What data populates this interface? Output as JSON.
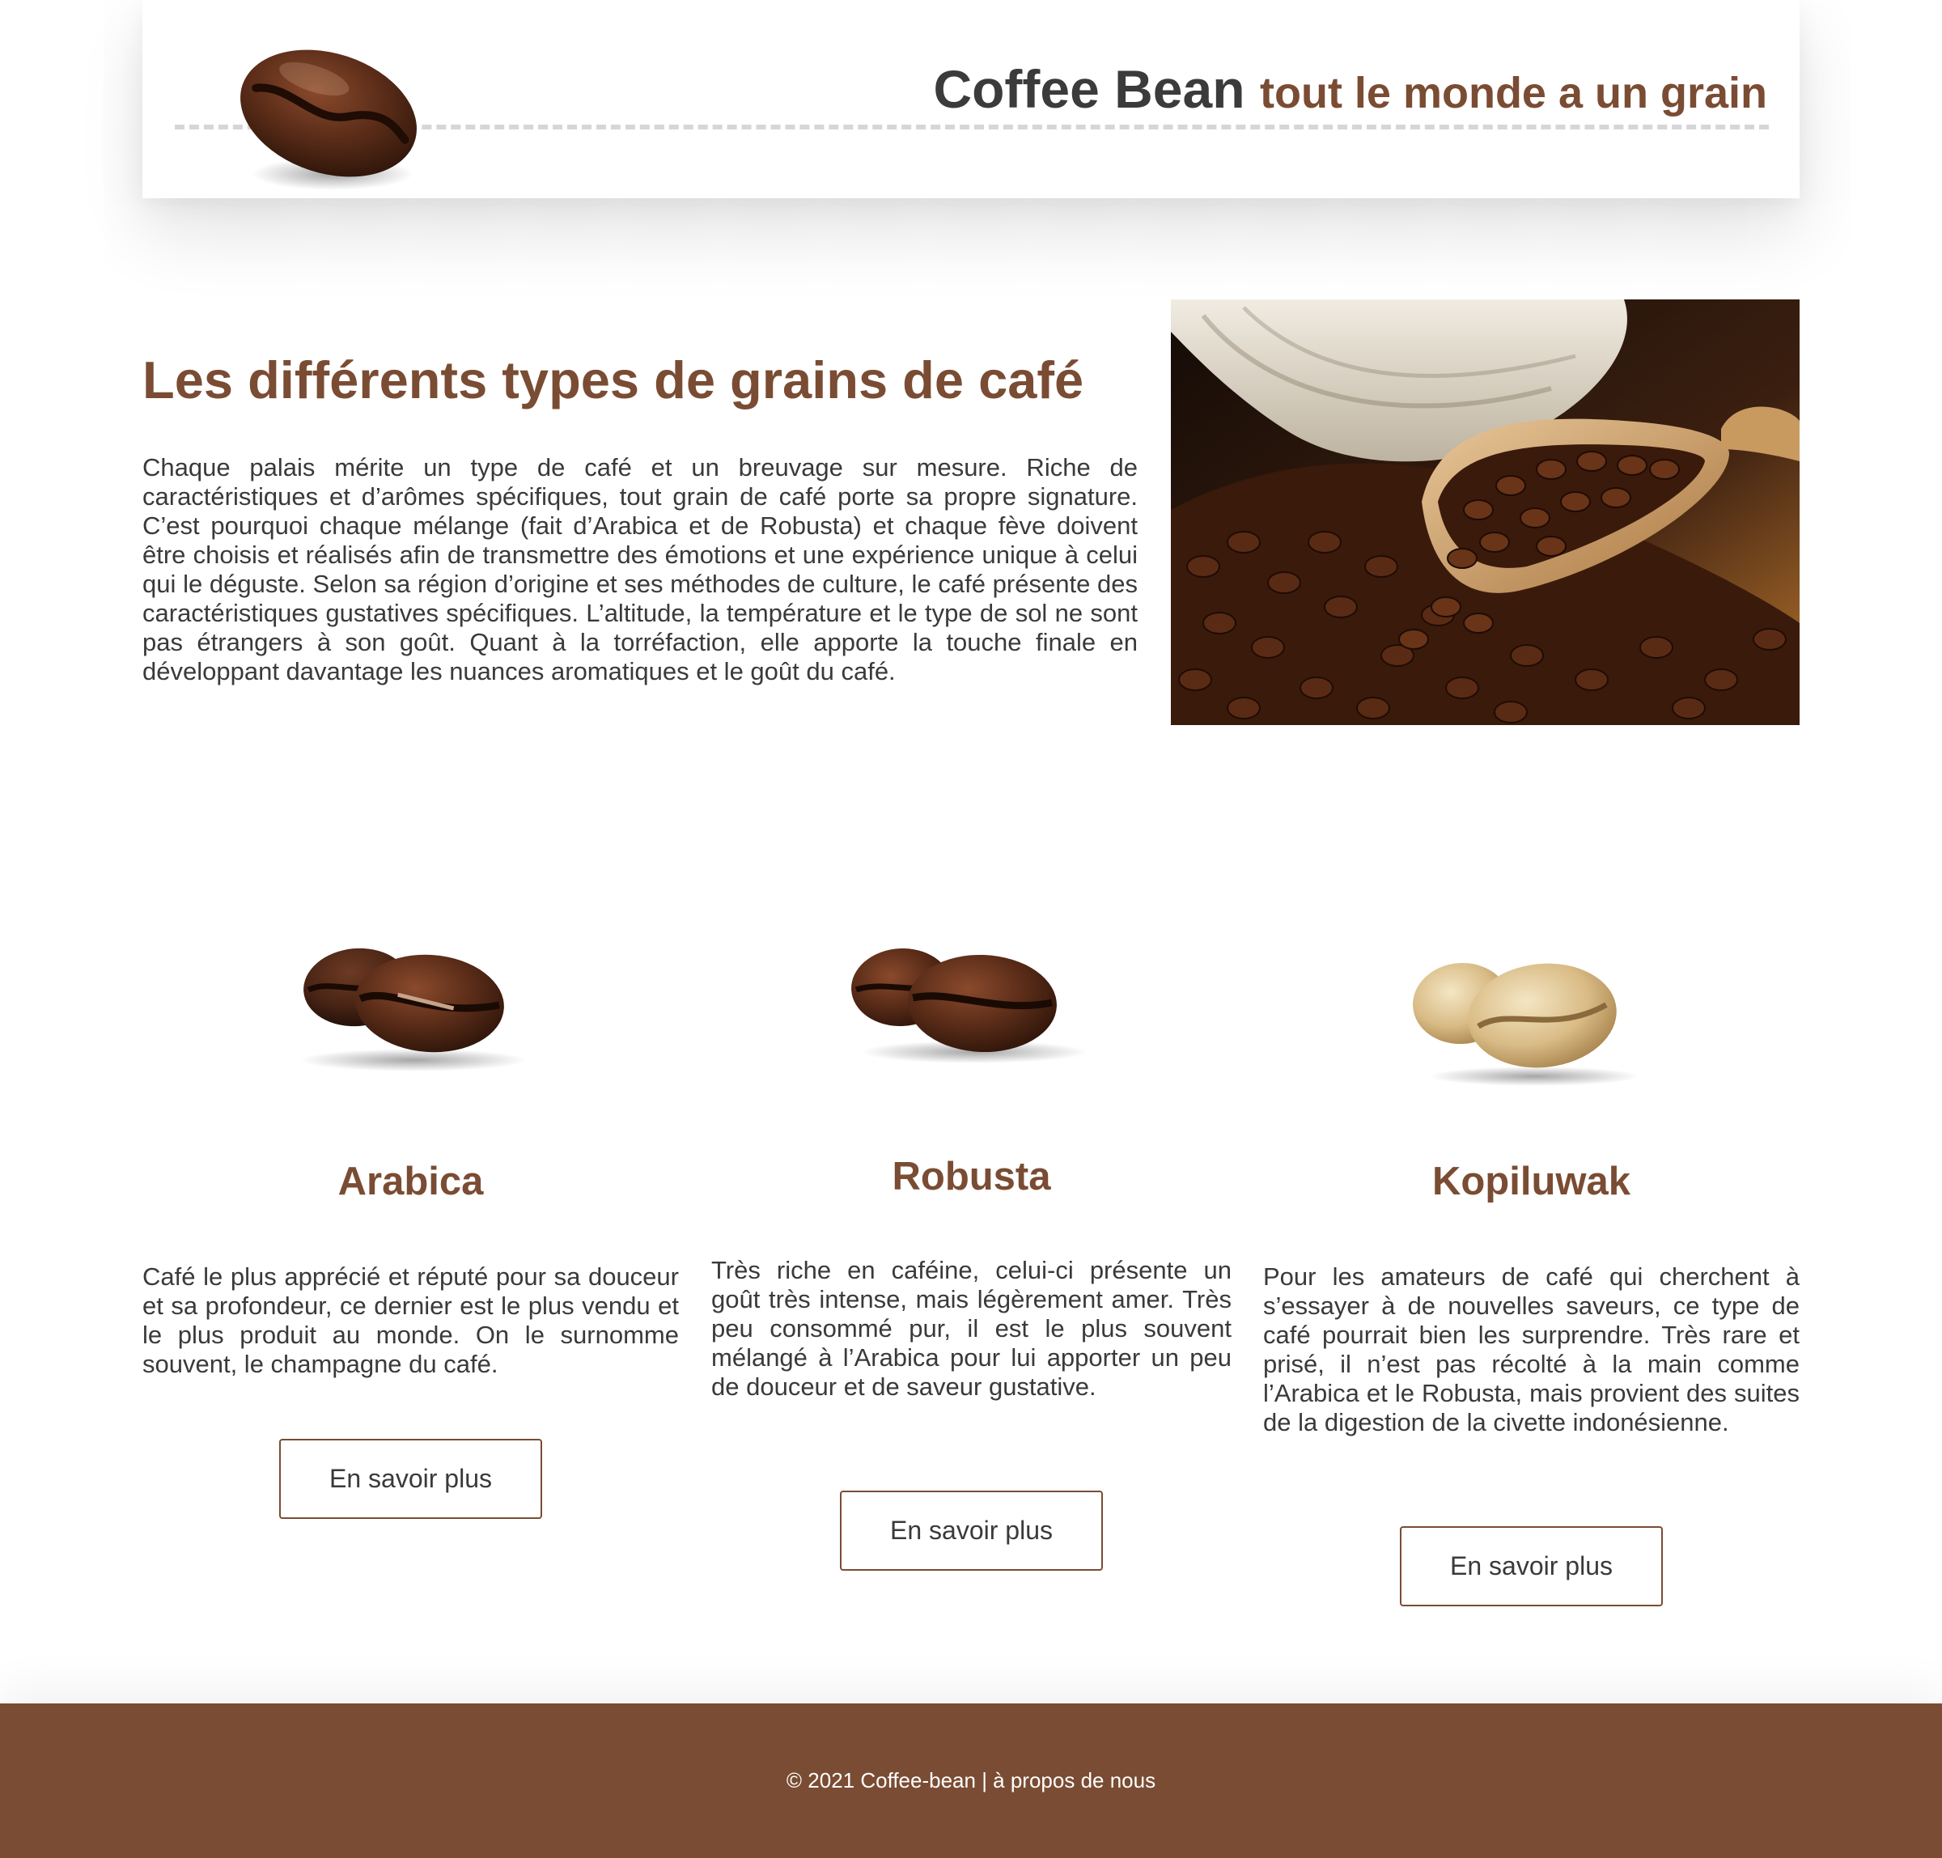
{
  "header": {
    "brand_name": "Coffee Bean",
    "tagline": "tout le monde a un grain",
    "logo_icon": "coffee-bean-icon"
  },
  "intro": {
    "title": "Les différents types de grains de café",
    "text": "Chaque palais mérite un type de café et un breuvage sur mesure. Riche de caractéristiques et d’arômes spécifiques, tout grain de café porte sa propre signature. C’est pourquoi chaque mélange (fait d’Arabica et de Robusta) et chaque fève doivent être choisis et réalisés afin de transmettre des émotions et une expérience unique à celui qui le déguste. Selon sa région d’origine et ses méthodes de culture, le café présente des caractéristiques gustatives spécifiques. L’altitude, la température et le type de sol ne sont pas étrangers à son goût. Quant à la torréfaction, elle apporte la touche finale en développant davantage les nuances aromatiques et le goût du café.",
    "image": "coffee-beans-scoop-photo"
  },
  "cards": [
    {
      "title": "Arabica",
      "text": "Café le plus apprécié et réputé pour sa douceur et sa profondeur, ce dernier est le plus vendu et le plus produit au monde. On le surnomme souvent, le champagne du café.",
      "button": "En savoir plus",
      "image": "arabica-beans-photo"
    },
    {
      "title": "Robusta",
      "text": "Très riche en caféine, celui-ci présente un goût très intense, mais légèrement amer. Très peu consommé pur, il est le plus souvent mélangé à l’Arabica pour lui apporter un peu de douceur et de saveur gustative.",
      "button": "En savoir plus",
      "image": "robusta-beans-photo"
    },
    {
      "title": "Kopiluwak",
      "text": "Pour les amateurs de café qui cherchent à s’essayer à de nouvelles saveurs, ce type de café pourrait bien les surprendre. Très rare et prisé, il n’est pas récolté à la main comme l’Arabica et le Robusta, mais provient des suites de la digestion de la civette indonésienne.",
      "button": "En savoir plus",
      "image": "kopiluwak-beans-photo"
    }
  ],
  "footer": {
    "text": "© 2021 Coffee-bean | à propos de nous"
  },
  "colors": {
    "brand_brown": "#7a4c33",
    "text_dark": "#3a3a3a",
    "footer_bg": "#7a4c33"
  }
}
